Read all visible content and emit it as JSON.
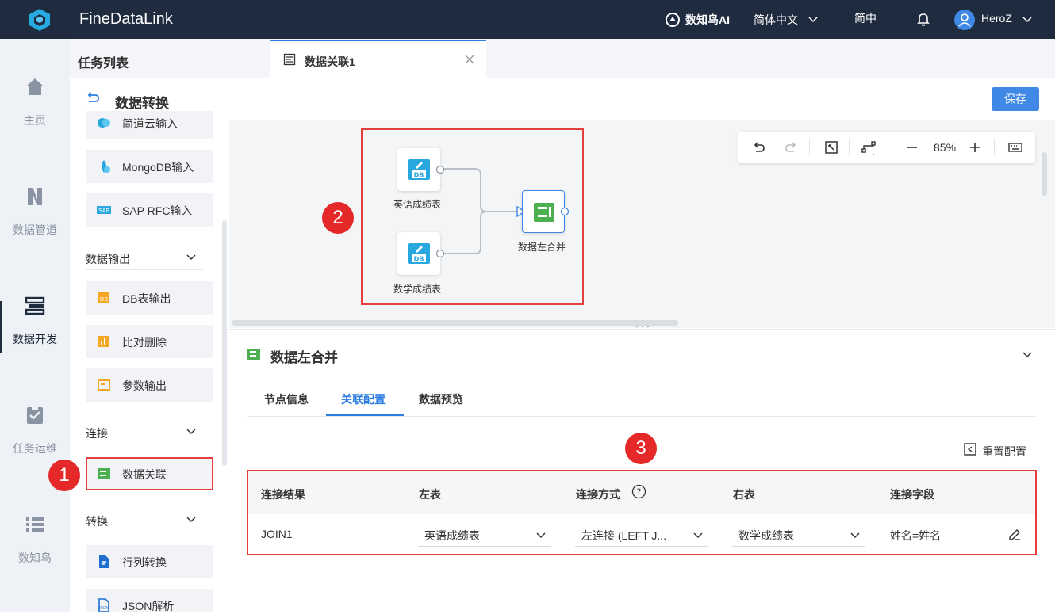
{
  "header": {
    "app_name": "FineDataLink",
    "ai_label": "数知鸟AI",
    "language": "简体中文",
    "lang_short": "简中",
    "user": "HeroZ"
  },
  "nav": {
    "items": [
      {
        "label": "主页",
        "icon": "home-icon"
      },
      {
        "label": "数据管道",
        "icon": "pipeline-icon"
      },
      {
        "label": "数据开发",
        "icon": "dev-icon"
      },
      {
        "label": "任务运维",
        "icon": "ops-icon"
      },
      {
        "label": "数知鸟",
        "icon": "list-icon"
      }
    ],
    "active": "数据开发"
  },
  "tasklist": {
    "title": "任务列表"
  },
  "tab": {
    "title": "数据关联1"
  },
  "toolbar": {
    "title": "数据转换",
    "save_label": "保存"
  },
  "sidebar": {
    "items_top": [
      "简道云输入",
      "MongoDB输入",
      "SAP RFC输入"
    ],
    "section_output": "数据输出",
    "output_items": [
      "DB表输出",
      "比对删除",
      "参数输出"
    ],
    "section_join": "连接",
    "join_items": [
      "数据关联"
    ],
    "section_transform": "转换",
    "transform_items": [
      "行列转换",
      "JSON解析"
    ]
  },
  "canvas": {
    "zoom": "85%",
    "nodes": [
      {
        "label": "英语成绩表",
        "badge": "DB"
      },
      {
        "label": "数学成绩表",
        "badge": "DB"
      },
      {
        "label": "数据左合并"
      }
    ]
  },
  "annotations": {
    "badge1": "1",
    "badge2": "2",
    "badge3": "3"
  },
  "panel": {
    "title": "数据左合并",
    "tabs": [
      "节点信息",
      "关联配置",
      "数据预览"
    ],
    "active_tab": "关联配置",
    "reset_label": "重置配置",
    "table": {
      "headers": [
        "连接结果",
        "左表",
        "连接方式",
        "右表",
        "连接字段"
      ],
      "row": {
        "result": "JOIN1",
        "left": "英语成绩表",
        "method": "左连接 (LEFT J...",
        "right": "数学成绩表",
        "field": "姓名=姓名"
      }
    }
  },
  "colors": {
    "topbar": "#1f2b3e",
    "accent": "#2b7de1",
    "highlight": "#e53e3e",
    "node_green": "#4caf50",
    "db_blue": "#29a8e0"
  }
}
